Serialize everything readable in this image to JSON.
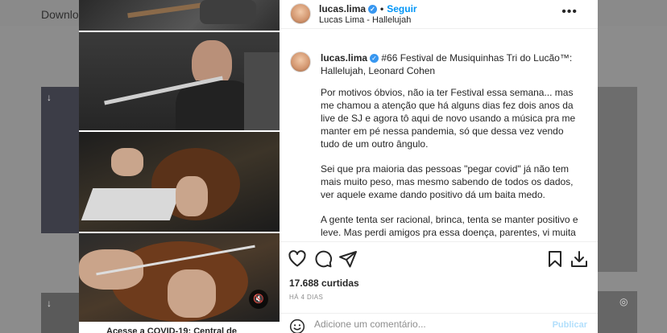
{
  "background": {
    "download_label": "Downloa"
  },
  "post": {
    "header": {
      "username": "lucas.lima",
      "follow_label": "Seguir",
      "subtitle": "Lucas Lima - Hallelujah",
      "more_icon": "more-dots-icon"
    },
    "caption": {
      "username": "lucas.lima",
      "title": "#66 Festival de Musiquinhas Tri do Lucão™: Hallelujah, Leonard Cohen",
      "paragraphs": [
        "Por motivos óbvios, não ia ter Festival essa semana... mas me chamou a atenção que há alguns dias fez dois anos da live de SJ e agora tô aqui de novo usando a música pra me manter em pé nessa pandemia, só que dessa vez vendo tudo de um outro ângulo.",
        "Sei que pra maioria das pessoas \"pegar covid\" já não tem mais muito peso, mas mesmo sabendo de todos os dados, ver aquele exame dando positivo dá um baita medo.",
        "A gente tenta ser racional, brinca, tenta se manter positivo e leve. Mas perdi amigos pra essa doença, parentes, vi muita vida literal e figurativa indo e se esvaindo pela janela. E agora que nesse pandemia, de uma forma muito estranha, me sinto conectado com"
      ]
    },
    "media_caption": "Acesse a COVID-19: Central de",
    "likes": "17.688 curtidas",
    "time": "HÁ 4 DIAS",
    "comment_placeholder": "Adicione um comentário...",
    "publish_label": "Publicar",
    "colors": {
      "accent": "#0095f6",
      "publish_disabled": "#b2dffc",
      "verified": "#3897f0"
    }
  }
}
